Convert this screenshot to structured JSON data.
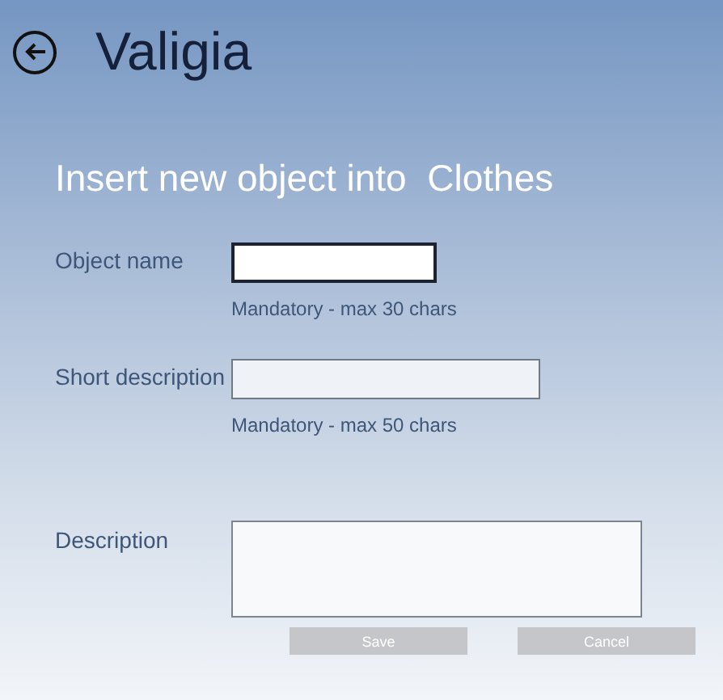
{
  "header": {
    "title": "Valigia"
  },
  "subtitle": "Insert new object into  Clothes",
  "fields": [
    {
      "kind": "single",
      "label": "Object name",
      "focused": true,
      "hint": "Mandatory - max 30 chars"
    },
    {
      "kind": "single",
      "label": "Short description",
      "focused": false,
      "hint": "Mandatory - max 50 chars"
    },
    {
      "kind": "multi",
      "label": "Description",
      "focused": false
    }
  ],
  "buttons": [
    {
      "label": "Save",
      "disabled": true
    },
    {
      "label": "Cancel",
      "disabled": true
    }
  ]
}
